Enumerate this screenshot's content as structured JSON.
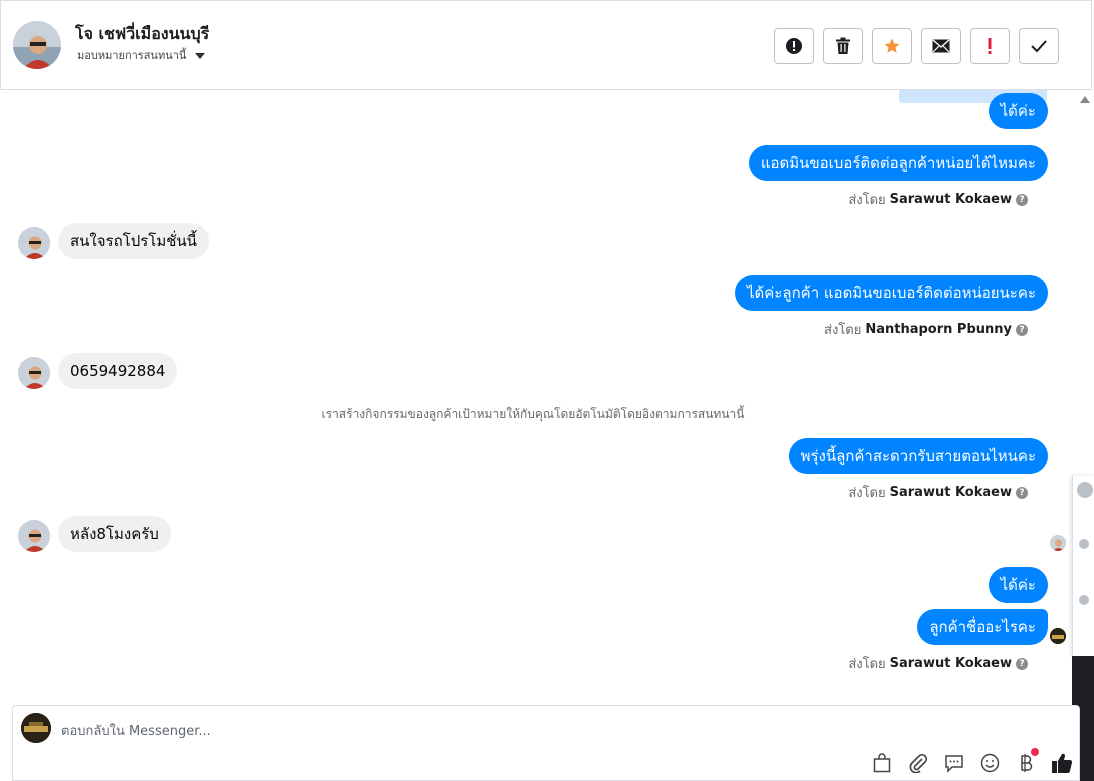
{
  "header": {
    "contact_name": "โจ เชฟวี่เมืองนนบุรี",
    "assign_label": "มอบหมายการสนทนานี้"
  },
  "toolbar": [
    {
      "name": "spam-button",
      "icon": "alert-circle-icon"
    },
    {
      "name": "delete-button",
      "icon": "trash-icon"
    },
    {
      "name": "star-button",
      "icon": "star-icon",
      "color": "#f7923b"
    },
    {
      "name": "mark-unread-button",
      "icon": "envelope-icon"
    },
    {
      "name": "follow-up-button",
      "icon": "exclamation-icon",
      "color": "#e41e3f"
    },
    {
      "name": "mark-done-button",
      "icon": "check-icon"
    }
  ],
  "messages": {
    "m1": "ได้ค่ะ",
    "m2": "แอดมินขอเบอร์ติดต่อลูกค้าหน่อยได้ไหมคะ",
    "m3": "สนใจรถโปรโมชั่นนี้",
    "m4": "ได้ค่ะลูกค้า แอดมินขอเบอร์ติดต่อหน่อยนะคะ",
    "m5": "0659492884",
    "system": "เราสร้างกิจกรรมของลูกค้าเป้าหมายให้กับคุณโดยอัตโนมัติโดยอิงตามการสนทนานี้",
    "m6": "พรุ่งนี้ลูกค้าสะดวกรับสายตอนไหนคะ",
    "m7": "หลัง8โมงครับ",
    "m8": "ได้ค่ะ",
    "m9": "ลูกค้าชื่ออะไรคะ"
  },
  "sent_by": {
    "prefix": "ส่งโดย",
    "s1": "Sarawut Kokaew",
    "s2": "Nanthaporn Pbunny",
    "s3": "Sarawut Kokaew",
    "s4": "Sarawut Kokaew"
  },
  "composer": {
    "placeholder": "ตอบกลับใน Messenger..."
  },
  "colors": {
    "outgoing_bubble": "#0084ff",
    "incoming_bubble": "#eff0f2"
  }
}
